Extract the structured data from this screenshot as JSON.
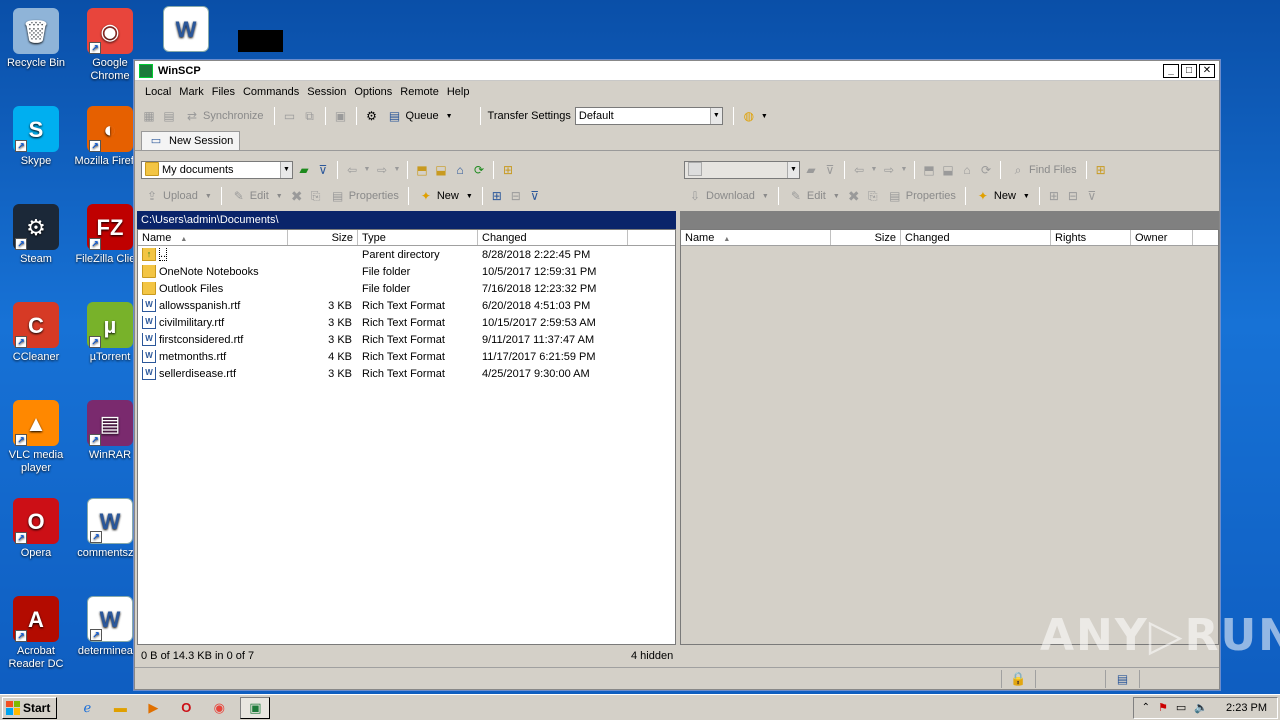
{
  "desktop": {
    "icons": [
      {
        "label": "Recycle Bin",
        "icon": "recycle-bin-icon",
        "color": "#8fb4d8",
        "glyph": "🗑"
      },
      {
        "label": "Google Chrome",
        "icon": "chrome-icon",
        "color": "#e8453c",
        "glyph": "◉"
      },
      {
        "label": "Skype",
        "icon": "skype-icon",
        "color": "#00aff0",
        "glyph": "S"
      },
      {
        "label": "Mozilla Firefox",
        "icon": "firefox-icon",
        "color": "#e66000",
        "glyph": "◐"
      },
      {
        "label": "Steam",
        "icon": "steam-icon",
        "color": "#1b2838",
        "glyph": "⚙"
      },
      {
        "label": "FileZilla Client",
        "icon": "filezilla-icon",
        "color": "#bf0000",
        "glyph": "FZ"
      },
      {
        "label": "CCleaner",
        "icon": "ccleaner-icon",
        "color": "#d63a25",
        "glyph": "C"
      },
      {
        "label": "µTorrent",
        "icon": "utorrent-icon",
        "color": "#78b22a",
        "glyph": "µ"
      },
      {
        "label": "VLC media player",
        "icon": "vlc-icon",
        "color": "#ff8800",
        "glyph": "▲"
      },
      {
        "label": "WinRAR",
        "icon": "winrar-icon",
        "color": "#7a2a6e",
        "glyph": "▤"
      },
      {
        "label": "Opera",
        "icon": "opera-icon",
        "color": "#cc0f16",
        "glyph": "O"
      },
      {
        "label": "commentsz...",
        "icon": "word-doc-icon",
        "color": "#ffffff",
        "glyph": "W"
      },
      {
        "label": "Acrobat Reader DC",
        "icon": "acrobat-icon",
        "color": "#b30b00",
        "glyph": "A"
      },
      {
        "label": "determinea...",
        "icon": "word-doc-icon",
        "color": "#ffffff",
        "glyph": "W"
      }
    ],
    "top_word_glyph": "W"
  },
  "window": {
    "title": "WinSCP",
    "ctrl_min": "_",
    "ctrl_max": "□",
    "ctrl_close": "✕",
    "menu": [
      "Local",
      "Mark",
      "Files",
      "Commands",
      "Session",
      "Options",
      "Remote",
      "Help"
    ],
    "toolbar": {
      "synchronize": "Synchronize",
      "queue": "Queue",
      "transfer_settings_label": "Transfer Settings",
      "transfer_settings_value": "Default"
    },
    "tab": {
      "label": "New Session"
    }
  },
  "left_pane": {
    "location": "My documents",
    "actions": {
      "upload": "Upload",
      "edit": "Edit",
      "properties": "Properties",
      "new": "New"
    },
    "path": "C:\\Users\\admin\\Documents\\",
    "columns": [
      "Name",
      "Size",
      "Type",
      "Changed"
    ],
    "rows": [
      {
        "name": "..",
        "size": "",
        "type": "Parent directory",
        "changed": "8/28/2018  2:22:45 PM",
        "kind": "up"
      },
      {
        "name": "OneNote Notebooks",
        "size": "",
        "type": "File folder",
        "changed": "10/5/2017  12:59:31 PM",
        "kind": "folder"
      },
      {
        "name": "Outlook Files",
        "size": "",
        "type": "File folder",
        "changed": "7/16/2018  12:23:32 PM",
        "kind": "folder"
      },
      {
        "name": "allowsspanish.rtf",
        "size": "3 KB",
        "type": "Rich Text Format",
        "changed": "6/20/2018  4:51:03 PM",
        "kind": "rtf"
      },
      {
        "name": "civilmilitary.rtf",
        "size": "3 KB",
        "type": "Rich Text Format",
        "changed": "10/15/2017  2:59:53 AM",
        "kind": "rtf"
      },
      {
        "name": "firstconsidered.rtf",
        "size": "3 KB",
        "type": "Rich Text Format",
        "changed": "9/11/2017  11:37:47 AM",
        "kind": "rtf"
      },
      {
        "name": "metmonths.rtf",
        "size": "4 KB",
        "type": "Rich Text Format",
        "changed": "11/17/2017  6:21:59 PM",
        "kind": "rtf"
      },
      {
        "name": "sellerdisease.rtf",
        "size": "3 KB",
        "type": "Rich Text Format",
        "changed": "4/25/2017  9:30:00 AM",
        "kind": "rtf"
      }
    ],
    "status_left": "0 B of 14.3 KB in 0 of 7",
    "status_right": "4 hidden"
  },
  "right_pane": {
    "find_files": "Find Files",
    "actions": {
      "download": "Download",
      "edit": "Edit",
      "properties": "Properties",
      "new": "New"
    },
    "columns": [
      "Name",
      "Size",
      "Changed",
      "Rights",
      "Owner"
    ]
  },
  "taskbar": {
    "start_label": "Start",
    "clock": "2:23 PM"
  },
  "watermark": "ANY▷RUN"
}
